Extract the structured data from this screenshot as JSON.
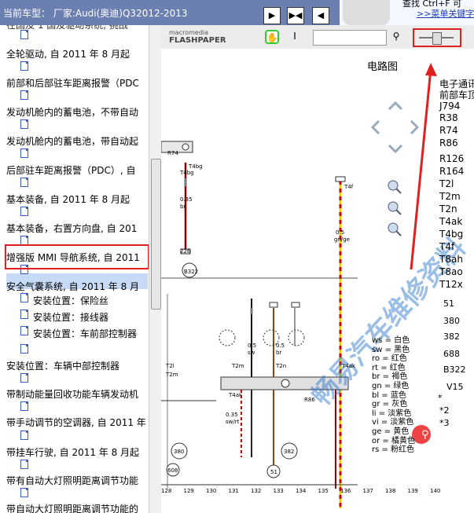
{
  "app": {
    "title": "当前车型： 厂家:Audi(奥迪)Q32012-2013",
    "hint_text": "查找 Ctrl+F 可",
    "menu_link": ">>菜单关键字"
  },
  "sidebar": {
    "items": [
      {
        "label": "全轮驱动, 自 2011 年 8 月起"
      },
      {
        "label": "前部和后部驻车距离报警（PDC"
      },
      {
        "label": "发动机舱内的蓄电池，不带自动"
      },
      {
        "label": "发动机舱内的蓄电池，带自动起"
      },
      {
        "label": "后部驻车距离报警（PDC）, 自"
      },
      {
        "label": "基本装备, 自 2011 年 8 月起"
      },
      {
        "label": "基本装备，右置方向盘, 自 201"
      },
      {
        "label": "增强版 MMI 导航系统, 自 2011",
        "selected": true
      },
      {
        "label": "安全气囊系统, 自 2011 年 8 月"
      },
      {
        "label": "安装位置：保险丝",
        "sub": true
      },
      {
        "label": "安装位置：接线器",
        "sub": true
      },
      {
        "label": "安装位置：车前部控制器",
        "sub": true
      },
      {
        "label": "安装位置：车辆中部控制器"
      },
      {
        "label": "带制动能量回收功能车辆发动机"
      },
      {
        "label": "带手动调节的空调器, 自 2011 年"
      },
      {
        "label": "带挂车行驶, 自 2011 年 8 月起"
      },
      {
        "label": "带有自动大灯照明距离调节功能"
      },
      {
        "label": "带自动大灯照明距离调节功能的"
      }
    ],
    "top_partial": "在国及 1 国及驱动系统, 挑战"
  },
  "toolbar": {
    "logo_small": "macromedia",
    "logo_big": "FLASHPAPER",
    "hand_icon": "hand-icon",
    "text_cursor_icon": "text-cursor-icon",
    "search_icon": "search-icon",
    "zoom_level": 0.5
  },
  "diagram": {
    "title": "电路图",
    "legend_header1": "电子通讯",
    "legend_header2": "前部车顶",
    "components": [
      "J794",
      "R38",
      "R74",
      "R86",
      "R126",
      "R164",
      "T2l",
      "T2m",
      "T2n",
      "T4ak",
      "T4bg",
      "T4f",
      "T8ah",
      "T8ao",
      "T12x"
    ],
    "codes": [
      "51",
      "380",
      "382",
      "688",
      "B322",
      "V15",
      "*",
      "*2",
      "*3"
    ],
    "colors": [
      "ws = 白色",
      "sw = 黑色",
      "ro = 红色",
      "rt = 红色",
      "br = 褐色",
      "gn = 绿色",
      "bl = 蓝色",
      "gr = 灰色",
      "li = 淡紫色",
      "vi = 淡紫色",
      "ge = 黄色",
      "or = 橘黄色",
      "rs = 粉红色"
    ],
    "bottom_numbers": [
      "128",
      "129",
      "130",
      "131",
      "132",
      "133",
      "134",
      "135",
      "136",
      "137",
      "138",
      "139",
      "140"
    ],
    "wire_labels": [
      "R74",
      "T4bg",
      "0.35",
      "br",
      "T4bg",
      "226",
      "B322",
      "T4f",
      "0.5",
      "gn/ge",
      "R86",
      "T4ak",
      "T4ak",
      "T2m",
      "T2n",
      "0.5",
      "sw",
      "0.5",
      "br",
      "0.35",
      "sw/rt",
      "380",
      "382",
      "608",
      "51",
      "T2l",
      "T2m"
    ],
    "watermark": "畅易汽车维修资料"
  }
}
